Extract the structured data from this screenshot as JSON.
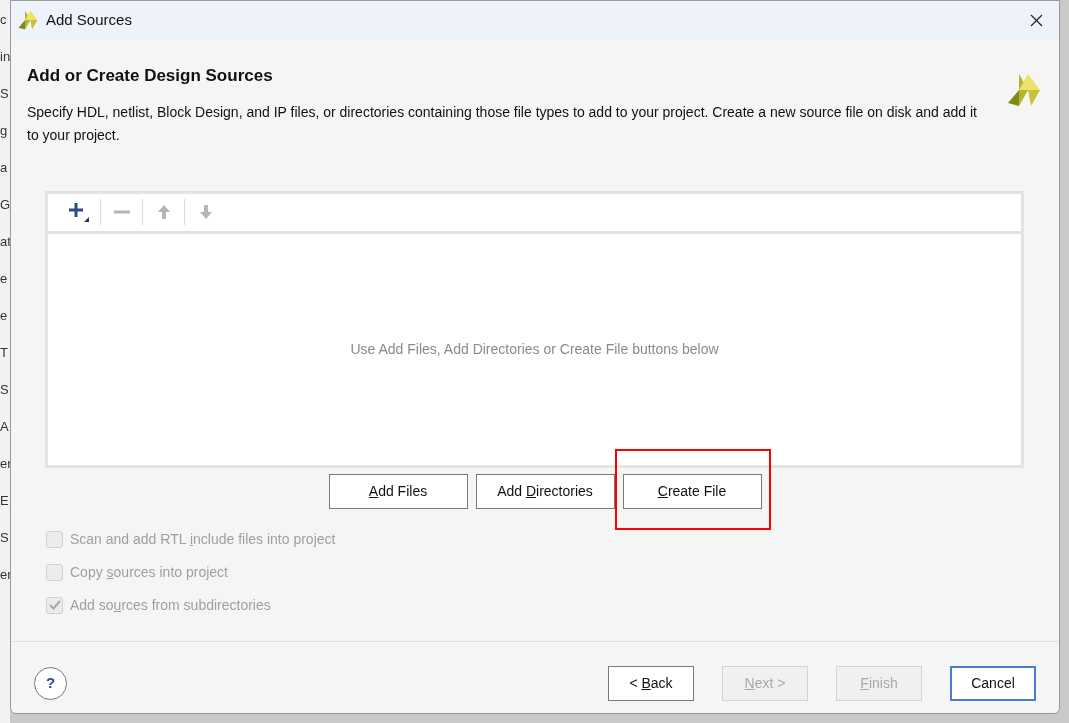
{
  "background_window": {
    "fragments": [
      "c",
      "in",
      "S",
      "g",
      "a",
      "G",
      "at",
      "e",
      "e",
      "T",
      "S",
      "A",
      "er",
      "E",
      "S",
      "er"
    ]
  },
  "window": {
    "title": "Add Sources"
  },
  "heading": "Add or Create Design Sources",
  "description": "Specify HDL, netlist, Block Design, and IP files, or directories containing those file types to add to your project. Create a new source file on disk and add it to your project.",
  "toolbar": [
    {
      "kind": "add",
      "disabled": false
    },
    {
      "kind": "remove",
      "disabled": true
    },
    {
      "kind": "up",
      "disabled": true
    },
    {
      "kind": "down",
      "disabled": true
    }
  ],
  "file_list": {
    "empty_message": "Use Add Files, Add Directories or Create File buttons below"
  },
  "actions": [
    {
      "label": {
        "key": "A",
        "post": "dd Files"
      },
      "highlighted": false
    },
    {
      "label": {
        "pre": "Add ",
        "key": "D",
        "post": "irectories"
      },
      "highlighted": false
    },
    {
      "label": {
        "key": "C",
        "post": "reate File"
      },
      "highlighted": true
    }
  ],
  "options": [
    {
      "label": {
        "pre": "Scan and add RTL ",
        "key": "i",
        "post": "nclude files into project"
      },
      "checked": false,
      "disabled": true
    },
    {
      "label": {
        "pre": "Copy ",
        "key": "s",
        "post": "ources into project"
      },
      "checked": false,
      "disabled": true
    },
    {
      "label": {
        "pre": "Add so",
        "key": "u",
        "post": "rces from subdirectories"
      },
      "checked": true,
      "disabled": true
    }
  ],
  "help": "?",
  "footer_buttons": [
    {
      "label": {
        "pre": "< ",
        "key": "B",
        "post": "ack"
      },
      "disabled": false,
      "focused": false
    },
    {
      "label": {
        "key": "N",
        "post": "ext >"
      },
      "disabled": true,
      "focused": false
    },
    {
      "label": {
        "key": "F",
        "post": "inish"
      },
      "disabled": true,
      "focused": false
    },
    {
      "label": {
        "pre": "Cancel"
      },
      "disabled": false,
      "focused": true
    }
  ]
}
